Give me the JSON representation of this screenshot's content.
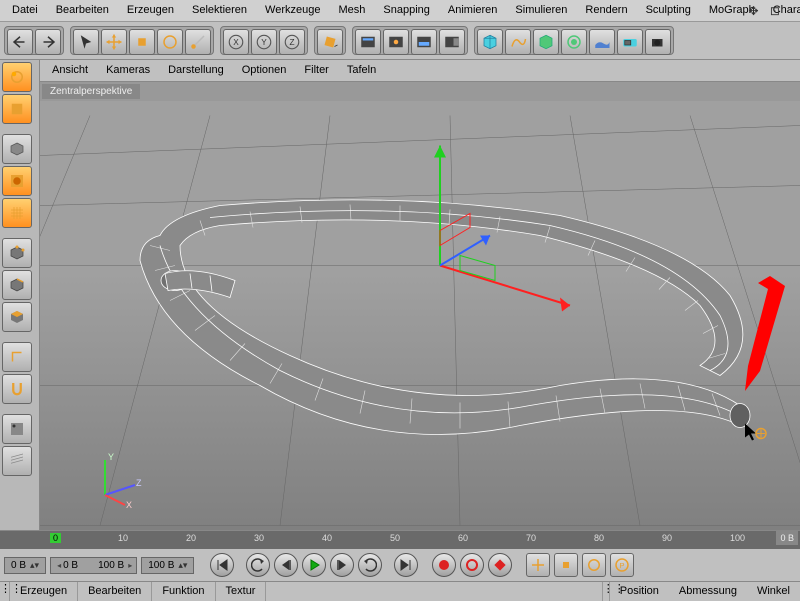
{
  "menu": {
    "items": [
      "Datei",
      "Bearbeiten",
      "Erzeugen",
      "Selektieren",
      "Werkzeuge",
      "Mesh",
      "Snapping",
      "Animieren",
      "Simulieren",
      "Rendern",
      "Sculpting",
      "MoGraph",
      "Charak"
    ]
  },
  "viewmenu": {
    "items": [
      "Ansicht",
      "Kameras",
      "Darstellung",
      "Optionen",
      "Filter",
      "Tafeln"
    ]
  },
  "viewport": {
    "label": "Zentralperspektive"
  },
  "timeline": {
    "ticks": [
      "0",
      "10",
      "20",
      "30",
      "40",
      "50",
      "60",
      "70",
      "80",
      "90",
      "100"
    ],
    "end_label": "0 B",
    "current": "0 B",
    "range_a": "0 B",
    "range_b": "100 B",
    "range_c": "100 B"
  },
  "bottom": {
    "tabs": [
      "Erzeugen",
      "Bearbeiten",
      "Funktion",
      "Textur"
    ],
    "attrs": [
      "Position",
      "Abmessung",
      "Winkel"
    ]
  },
  "axis": {
    "y": "Y",
    "z": "Z",
    "x": "X"
  }
}
